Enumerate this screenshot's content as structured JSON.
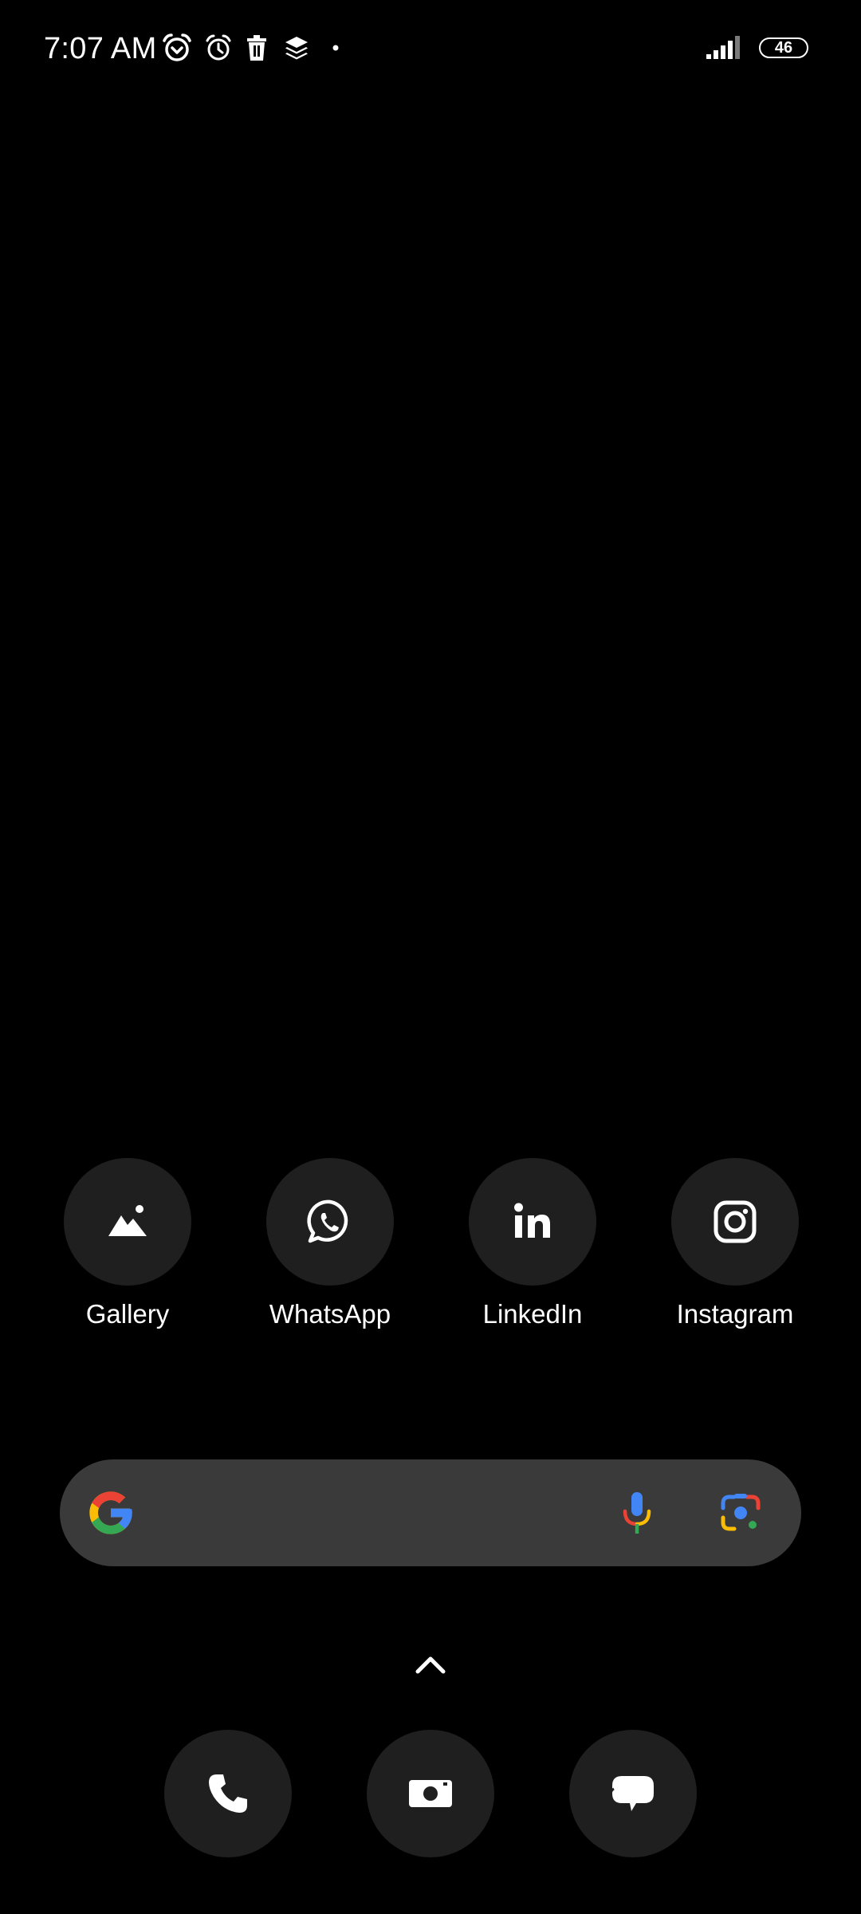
{
  "status_bar": {
    "time": "7:07 AM",
    "icons": [
      "alarm-clock-icon",
      "clock-icon",
      "trash-icon",
      "layers-icon",
      "dot-icon"
    ],
    "signal": "signal-bars-icon",
    "battery_level": "46"
  },
  "apps": [
    {
      "label": "Gallery",
      "icon": "gallery-icon"
    },
    {
      "label": "WhatsApp",
      "icon": "whatsapp-icon"
    },
    {
      "label": "LinkedIn",
      "icon": "linkedin-icon"
    },
    {
      "label": "Instagram",
      "icon": "instagram-icon"
    }
  ],
  "search_bar": {
    "icons": [
      "google-g-icon",
      "microphone-icon",
      "google-lens-icon"
    ],
    "colors": {
      "blue": "#4285F4",
      "red": "#EA4335",
      "yellow": "#FBBC05",
      "green": "#34A853",
      "background": "#3a3a3a"
    }
  },
  "dock": [
    {
      "icon": "phone-icon"
    },
    {
      "icon": "camera-icon"
    },
    {
      "icon": "messages-icon"
    }
  ],
  "colors": {
    "background": "#000000",
    "icon_circle": "#1f1f1f",
    "text": "#ffffff"
  }
}
